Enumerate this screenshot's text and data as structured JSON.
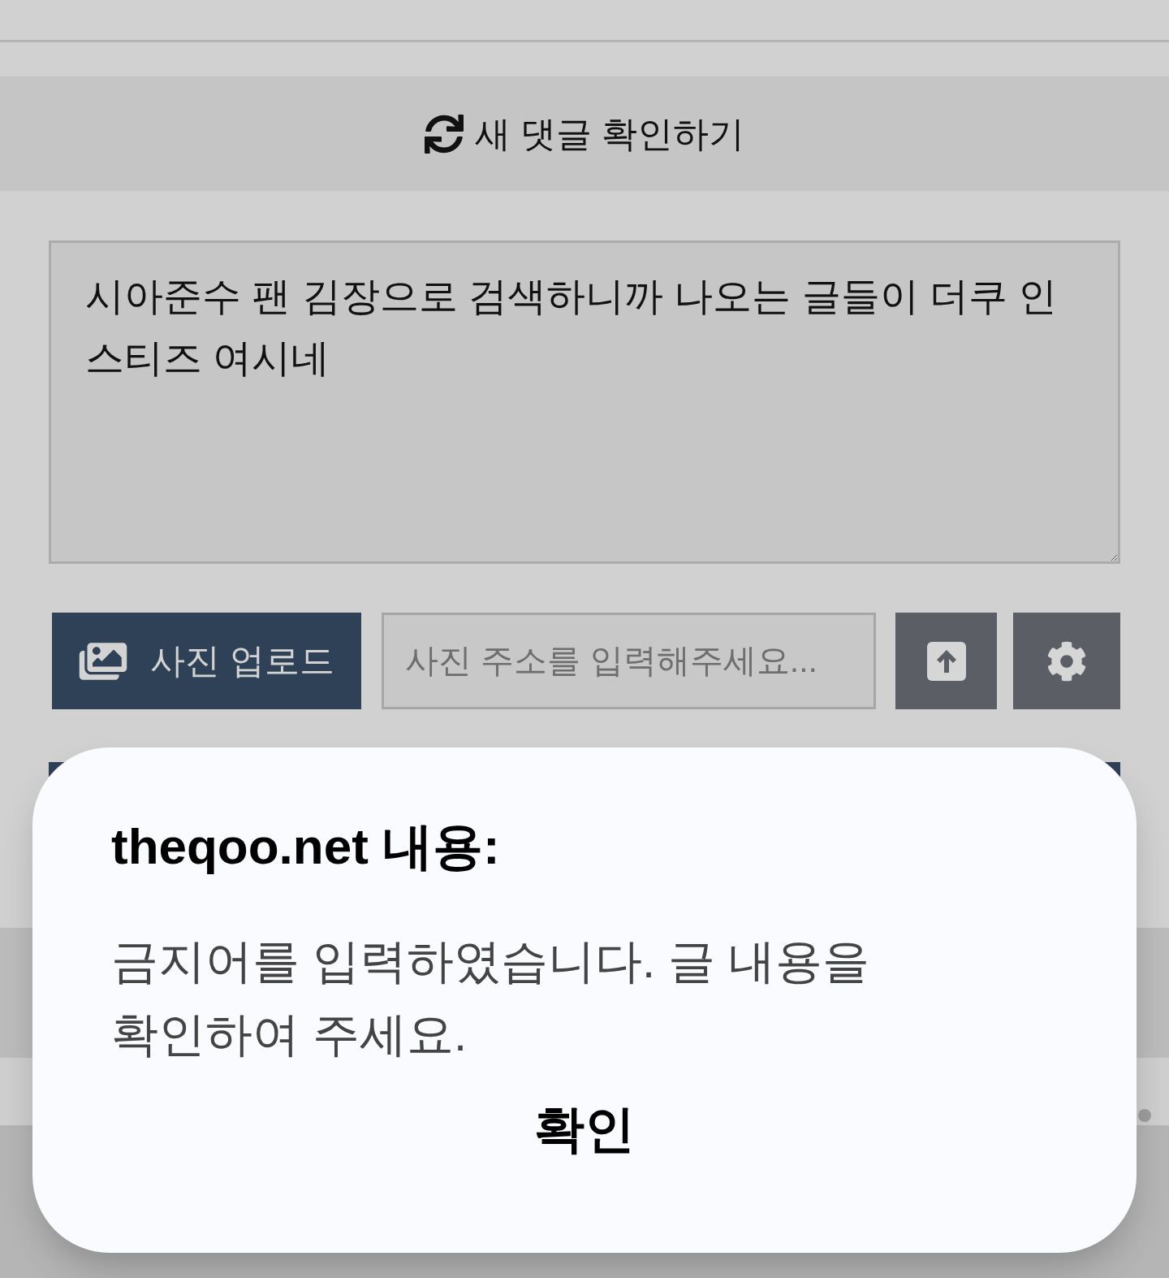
{
  "refresh_button": {
    "label": "새 댓글 확인하기"
  },
  "comment_box": {
    "value": "시아준수 팬 김장으로 검색하니까 나오는 글들이 더쿠 인스티즈 여시네"
  },
  "toolbar": {
    "upload_button": {
      "label": "사진 업로드"
    },
    "url_field": {
      "placeholder": "사진 주소를 입력해주세요..."
    }
  },
  "dialog": {
    "title": "theqoo.net 내용:",
    "message": "금지어를 입력하였습니다. 글 내용을 확인하여 주세요.",
    "button": "확인"
  }
}
